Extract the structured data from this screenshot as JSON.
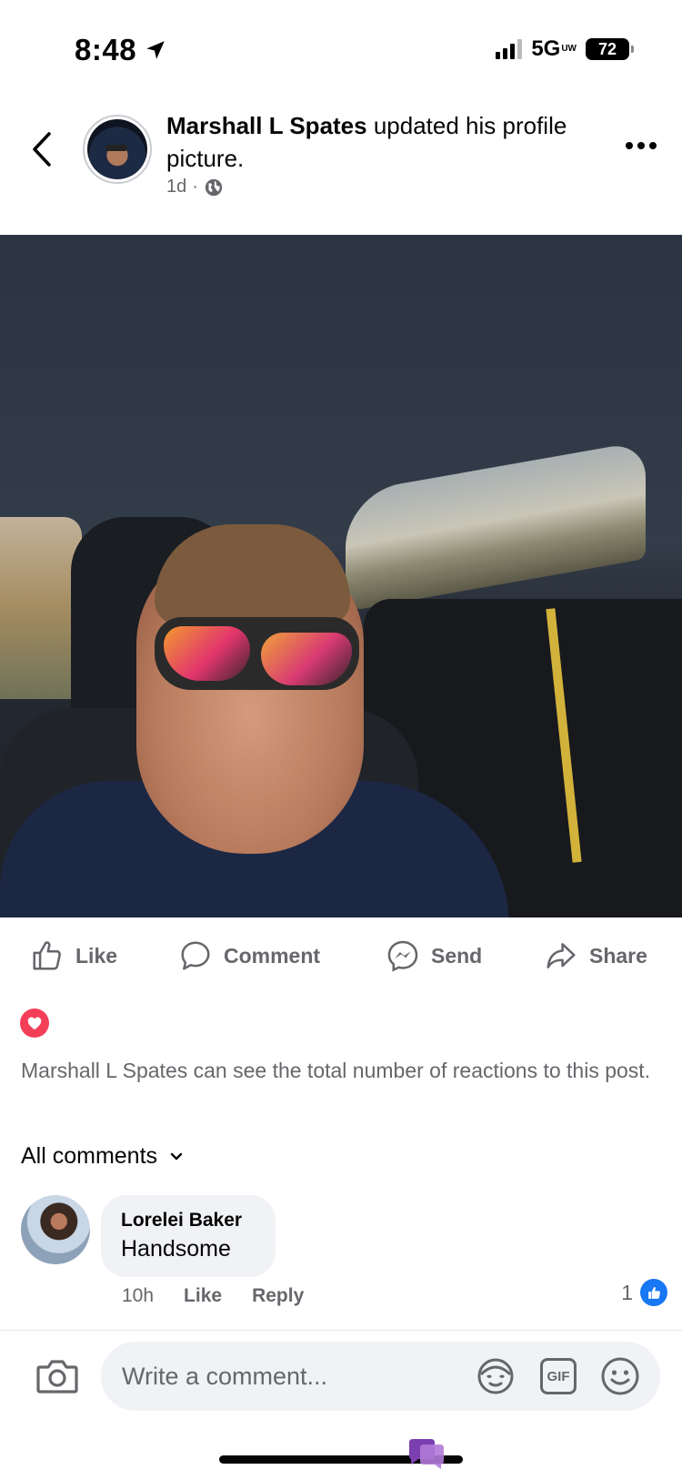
{
  "status_bar": {
    "time": "8:48",
    "network": "5G",
    "network_sub": "UW",
    "battery": "72"
  },
  "post": {
    "author": "Marshall L Spates",
    "action": " updated his profile picture.",
    "age": "1d",
    "separator": "·",
    "audience_icon": "globe-icon"
  },
  "actions": {
    "like": "Like",
    "comment": "Comment",
    "send": "Send",
    "share": "Share"
  },
  "reactions": {
    "note": "Marshall L Spates can see the total number of reactions to this post."
  },
  "comments_header": {
    "label": "All comments"
  },
  "comments": [
    {
      "name": "Lorelei Baker",
      "text": "Handsome",
      "age": "10h",
      "like_label": "Like",
      "reply_label": "Reply",
      "likes": "1"
    }
  ],
  "composer": {
    "placeholder": "Write a comment...",
    "gif_label": "GIF"
  },
  "colors": {
    "facebook_blue": "#1877f2",
    "heart_red": "#f33e58",
    "secondary_text": "#65676b",
    "bubble_bg": "#f0f2f5"
  }
}
